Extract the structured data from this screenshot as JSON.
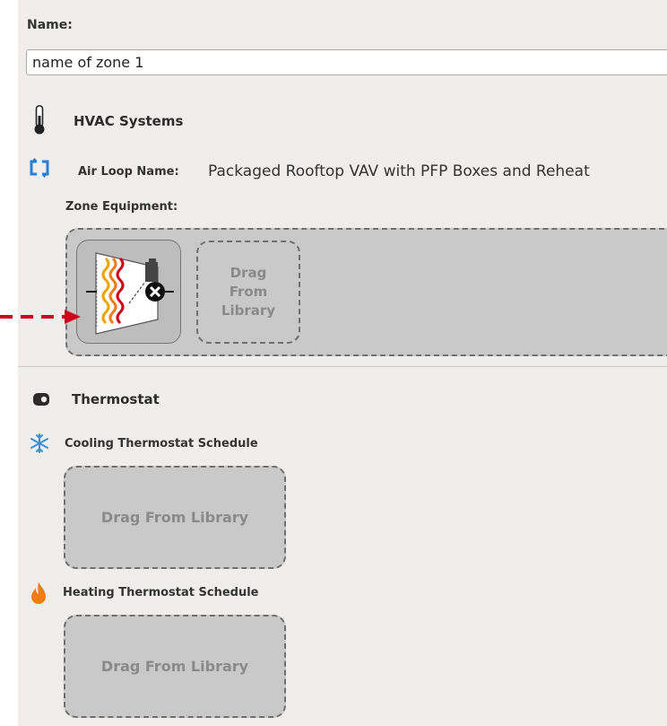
{
  "name_section": {
    "label": "Name:",
    "value": "name of zone 1"
  },
  "hvac": {
    "title": "HVAC Systems",
    "air_loop_label": "Air Loop Name:",
    "air_loop_value": "Packaged Rooftop VAV with PFP Boxes and Reheat",
    "zone_equipment_label": "Zone Equipment:",
    "equipment_item_icon": "pfp-terminal-reheat-icon",
    "drag_placeholder": "Drag From Library"
  },
  "thermostat": {
    "title": "Thermostat",
    "cooling_label": "Cooling Thermostat Schedule",
    "cooling_drag": "Drag From Library",
    "heating_label": "Heating Thermostat Schedule",
    "heating_drag": "Drag From Library"
  },
  "colors": {
    "panel_bg": "#efeeed",
    "drop_zone_bg": "#c9c9c9",
    "annotation_arrow": "#d0021b",
    "air_loop_icon": "#2a7fd4",
    "cooling_icon": "#3b8fd9",
    "heating_icon": "#f07d16"
  }
}
